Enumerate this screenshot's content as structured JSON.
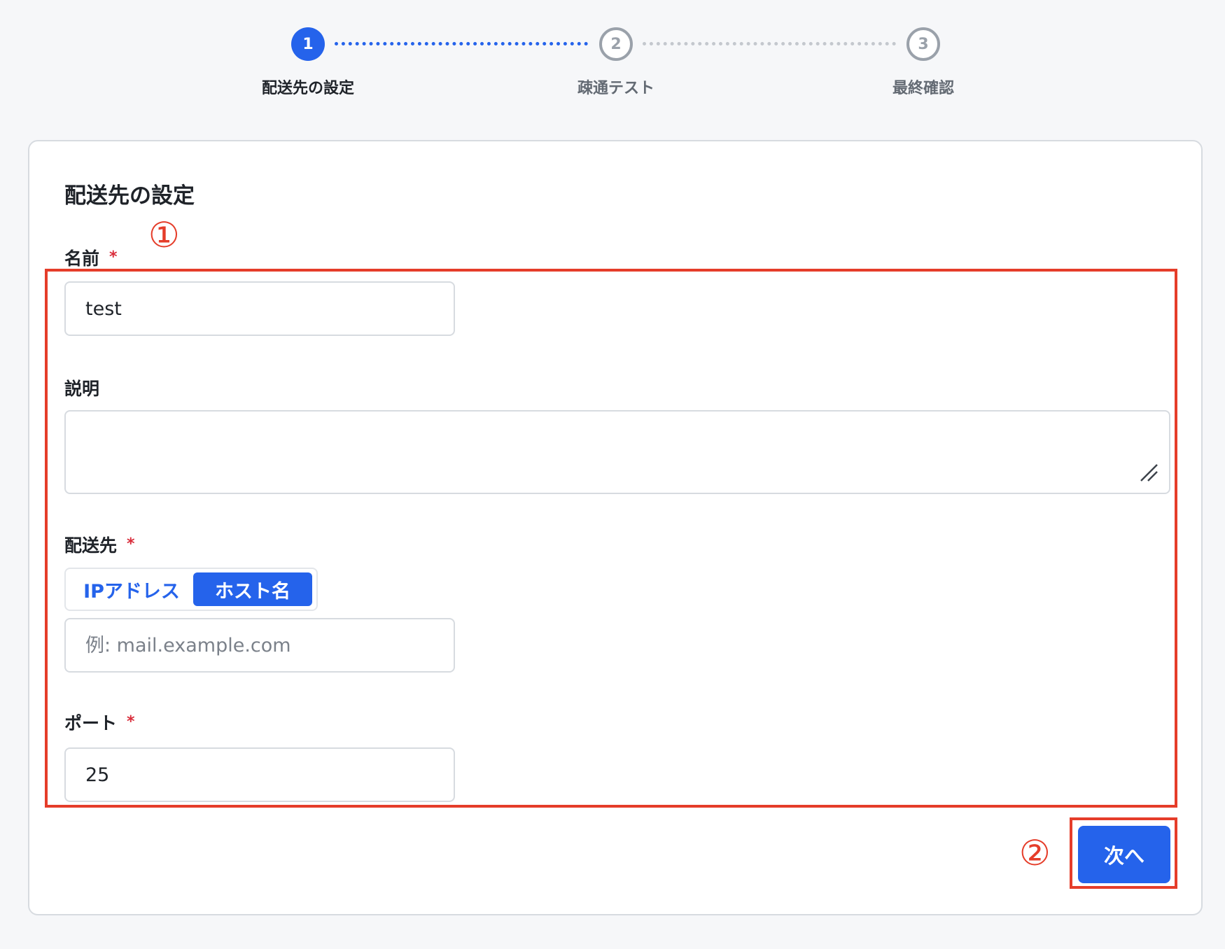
{
  "stepper": {
    "steps": [
      {
        "number": "1",
        "label": "配送先の設定",
        "state": "active"
      },
      {
        "number": "2",
        "label": "疎通テスト",
        "state": "inactive"
      },
      {
        "number": "3",
        "label": "最終確認",
        "state": "inactive"
      }
    ]
  },
  "form": {
    "title": "配送先の設定",
    "name": {
      "label": "名前",
      "required_mark": "*",
      "value": "test"
    },
    "description": {
      "label": "説明",
      "value": ""
    },
    "destination": {
      "label": "配送先",
      "required_mark": "*",
      "options": [
        "IPアドレス",
        "ホスト名"
      ],
      "selected": "ホスト名",
      "placeholder": "例: mail.example.com"
    },
    "port": {
      "label": "ポート",
      "required_mark": "*",
      "value": "25"
    },
    "next_button": "次へ"
  },
  "annotations": {
    "marker_1": "①",
    "marker_2": "②",
    "color": "#e53d2a"
  },
  "colors": {
    "primary": "#2563eb",
    "required": "#d92d3b",
    "inactive_step": "#9aa1aa"
  }
}
